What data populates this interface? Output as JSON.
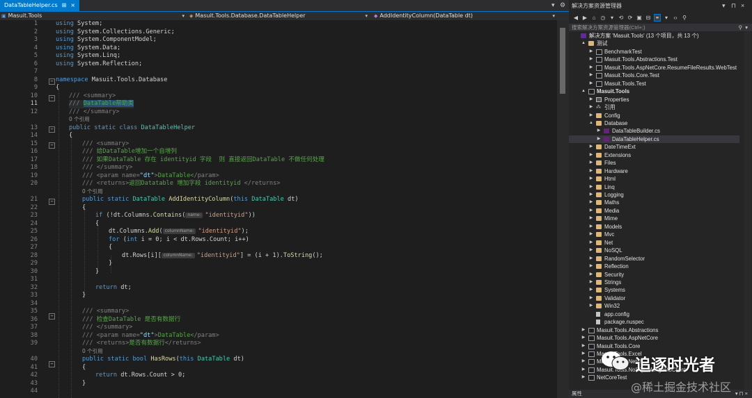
{
  "editor": {
    "tab": {
      "title": "DataTableHelper.cs",
      "pin": "⊞",
      "close": "×"
    },
    "tab_controls": {
      "dropdown": "▾",
      "settings": "⚙"
    },
    "nav": {
      "project": "Masuit.Tools",
      "type": "Masuit.Tools.Database.DataTableHelper",
      "member": "AddIdentityColumn(DataTable dt)"
    },
    "line_numbers": [
      "1",
      "2",
      "3",
      "4",
      "5",
      "6",
      "7",
      "8",
      "9",
      "10",
      "11",
      "12",
      "13",
      "14",
      "15",
      "16",
      "17",
      "18",
      "19",
      "20",
      "21",
      "22",
      "23",
      "24",
      "25",
      "26",
      "27",
      "28",
      "29",
      "30",
      "31",
      "32",
      "33",
      "34",
      "35",
      "36",
      "37",
      "38",
      "39",
      "40",
      "41",
      "42",
      "43",
      "44"
    ],
    "ref_counts": {
      "class": "0 个引用",
      "add_identity": "0 个引用",
      "has_rows": "0 个引用"
    },
    "code": {
      "l1": [
        "using",
        " System;"
      ],
      "l2": [
        "using",
        " System.Collections.Generic;"
      ],
      "l3": [
        "using",
        " System.ComponentModel;"
      ],
      "l4": [
        "using",
        " System.Data;"
      ],
      "l5": [
        "using",
        " System.Linq;"
      ],
      "l6": [
        "using",
        " System.Reflection;"
      ],
      "l8": [
        "namespace",
        " Masuit.Tools.Database"
      ],
      "l9": "{",
      "l10": [
        "///",
        " <summary>"
      ],
      "l11": [
        "///",
        " ",
        "DataTable帮助类"
      ],
      "l12": [
        "///",
        " </summary>"
      ],
      "l13": [
        "public static class",
        " ",
        "DataTableHelper"
      ],
      "l14": "{",
      "l15": [
        "///",
        " <summary>"
      ],
      "l16": [
        "///",
        " 给DataTable增加一个自增列"
      ],
      "l17": [
        "///",
        " 如果DataTable 存在 identityid 字段  则 直接返回DataTable 不做任何处理"
      ],
      "l18": [
        "///",
        " </summary>"
      ],
      "l19": [
        "///",
        " <param name=",
        "\"dt\"",
        ">",
        "DataTable",
        "</param>"
      ],
      "l20": [
        "///",
        " <returns>",
        "返回Datatable 增加字段 identityid ",
        "</returns>"
      ],
      "l21": [
        "public static",
        " ",
        "DataTable",
        " ",
        "AddIdentityColumn",
        "(",
        "this",
        " ",
        "DataTable",
        " dt)"
      ],
      "l22": "{",
      "l23": [
        "if",
        " (!dt.Columns.",
        "Contains",
        "(",
        "name:",
        "\"identityid\"",
        "))"
      ],
      "l24": "{",
      "l25": [
        "dt.Columns.",
        "Add",
        "(",
        "columnName:",
        "\"identityid\"",
        ");"
      ],
      "l26": [
        "for",
        " (",
        "int",
        " i = 0; i < dt.Rows.Count; i++)"
      ],
      "l27": "{",
      "l28": [
        "dt.Rows[i][",
        "columnName:",
        "\"identityid\"",
        "] = (i + 1).",
        "ToString",
        "();"
      ],
      "l29": "}",
      "l30": "}",
      "l32": [
        "return",
        " dt;"
      ],
      "l33": "}",
      "l35": [
        "///",
        " <summary>"
      ],
      "l36": [
        "///",
        " 检查DataTable 是否有数据行"
      ],
      "l37": [
        "///",
        " </summary>"
      ],
      "l38": [
        "///",
        " <param name=",
        "\"dt\"",
        ">",
        "DataTable",
        "</param>"
      ],
      "l39": [
        "///",
        " <returns>",
        "是否有数据行",
        "</returns>"
      ],
      "l40": [
        "public static",
        " ",
        "bool",
        " ",
        "HasRows",
        "(",
        "this",
        " ",
        "DataTable",
        " dt)"
      ],
      "l41": "{",
      "l42": [
        "return",
        " dt.Rows.Count > 0;"
      ],
      "l43": "}"
    }
  },
  "solution_explorer": {
    "title": "解决方案资源管理器",
    "title_controls": {
      "dropdown": "▾",
      "pin": "⊓",
      "close": "×"
    },
    "toolbar": [
      "◀",
      "▶",
      "⌂",
      "◷",
      "▾",
      "⟲",
      "⟳",
      "▣",
      "⊟",
      "⚭",
      "▾",
      "‹›",
      "⚲"
    ],
    "search_placeholder": "搜索解决方案资源管理器(Ctrl+;)",
    "search_icon": "⚲",
    "search_dropdown": "▾",
    "nodes": [
      {
        "label": "解决方案 'Masuit.Tools' (13 个项目，共 13 个)",
        "icon": "solution-icon",
        "arrow": ""
      },
      {
        "label": "测试",
        "icon": "folder-icon",
        "arrow": "▲"
      },
      {
        "label": "BenchmarkTest",
        "icon": "project-icon",
        "arrow": "▶"
      },
      {
        "label": "Masuit.Tools.Abstractions.Test",
        "icon": "project-icon",
        "arrow": "▶"
      },
      {
        "label": "Masuit.Tools.AspNetCore.ResumeFileResults.WebTest",
        "icon": "project-icon",
        "arrow": "▶"
      },
      {
        "label": "Masuit.Tools.Core.Test",
        "icon": "project-icon",
        "arrow": "▶"
      },
      {
        "label": "Masuit.Tools.Test",
        "icon": "project-icon",
        "arrow": "▶"
      },
      {
        "label": "Masuit.Tools",
        "icon": "project-icon",
        "arrow": "▲"
      },
      {
        "label": "Properties",
        "icon": "properties-icon",
        "arrow": "▶"
      },
      {
        "label": "引用",
        "icon": "reference-icon",
        "arrow": "▶"
      },
      {
        "label": "Config",
        "icon": "folder-icon",
        "arrow": "▶"
      },
      {
        "label": "Database",
        "icon": "folder-icon",
        "arrow": "▲"
      },
      {
        "label": "DataTableBuilder.cs",
        "icon": "csharp-file-icon",
        "arrow": "▶"
      },
      {
        "label": "DataTableHelper.cs",
        "icon": "csharp-file-icon",
        "arrow": "▶"
      },
      {
        "label": "DateTimeExt",
        "icon": "folder-icon",
        "arrow": "▶"
      },
      {
        "label": "Extensions",
        "icon": "folder-icon",
        "arrow": "▶"
      },
      {
        "label": "Files",
        "icon": "folder-icon",
        "arrow": "▶"
      },
      {
        "label": "Hardware",
        "icon": "folder-icon",
        "arrow": "▶"
      },
      {
        "label": "Html",
        "icon": "folder-icon",
        "arrow": "▶"
      },
      {
        "label": "Linq",
        "icon": "folder-icon",
        "arrow": "▶"
      },
      {
        "label": "Logging",
        "icon": "folder-icon",
        "arrow": "▶"
      },
      {
        "label": "Maths",
        "icon": "folder-icon",
        "arrow": "▶"
      },
      {
        "label": "Media",
        "icon": "folder-icon",
        "arrow": "▶"
      },
      {
        "label": "Mime",
        "icon": "folder-icon",
        "arrow": "▶"
      },
      {
        "label": "Models",
        "icon": "folder-icon",
        "arrow": "▶"
      },
      {
        "label": "Mvc",
        "icon": "folder-icon",
        "arrow": "▶"
      },
      {
        "label": "Net",
        "icon": "folder-icon",
        "arrow": "▶"
      },
      {
        "label": "NoSQL",
        "icon": "folder-icon",
        "arrow": "▶"
      },
      {
        "label": "RandomSelector",
        "icon": "folder-icon",
        "arrow": "▶"
      },
      {
        "label": "Reflection",
        "icon": "folder-icon",
        "arrow": "▶"
      },
      {
        "label": "Security",
        "icon": "folder-icon",
        "arrow": "▶"
      },
      {
        "label": "Strings",
        "icon": "folder-icon",
        "arrow": "▶"
      },
      {
        "label": "Systems",
        "icon": "folder-icon",
        "arrow": "▶"
      },
      {
        "label": "Validator",
        "icon": "folder-icon",
        "arrow": "▶"
      },
      {
        "label": "Win32",
        "icon": "folder-icon",
        "arrow": "▶"
      },
      {
        "label": "app.config",
        "icon": "config-file-icon",
        "arrow": ""
      },
      {
        "label": "package.nuspec",
        "icon": "file-icon",
        "arrow": ""
      },
      {
        "label": "Masuit.Tools.Abstractions",
        "icon": "project-icon",
        "arrow": "▶"
      },
      {
        "label": "Masuit.Tools.AspNetCore",
        "icon": "project-icon",
        "arrow": "▶"
      },
      {
        "label": "Masuit.Tools.Core",
        "icon": "project-icon",
        "arrow": "▶"
      },
      {
        "label": "Masuit.Tools.Excel",
        "icon": "project-icon",
        "arrow": "▶"
      },
      {
        "label": "Masuit.Tools.Net45",
        "icon": "project-icon",
        "arrow": "▶"
      },
      {
        "label": "Masuit.Tools.NoSQL.MongoDBClient",
        "icon": "project-icon",
        "arrow": "▶"
      },
      {
        "label": "NetCoreTest",
        "icon": "project-icon",
        "arrow": "▶"
      }
    ],
    "bottom_label": "属性",
    "bottom_controls": "▾ ⊓ ×"
  },
  "watermark": {
    "name": "追逐时光者",
    "site": "@稀土掘金技术社区"
  }
}
